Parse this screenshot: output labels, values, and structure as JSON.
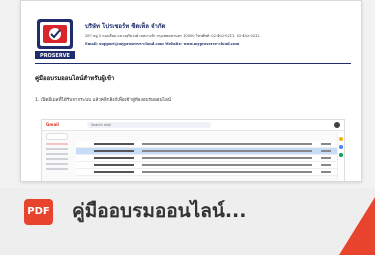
{
  "document": {
    "company_name": "บริษัท โปรเซอร์ท ซีดเท็ล จำกัด",
    "company_address": "287 หมู่ 5 ถนนสีลม แขวงสุริยวงศ์ เขตบางรัก กรุงเทพมหานคร 10500 โทรศัพท์: 02-402-0211, 02-402-0212",
    "company_contact": "Email: support@myproserve-cloud.com  Website: www.myproserve-cloud.com",
    "title": "คู่มืออบรมออนไลน์สำหรับผู้เข้า",
    "step_1": "1. เปิดอีเมลที่ได้รับจากระบบ แล้วคลิกลิงก์เพื่อเข้าสู่ห้องอบรมออนไลน์",
    "logo_text": "PROSERVE",
    "screenshot": {
      "app_name": "Gmail",
      "search_placeholder": "Search mail"
    }
  },
  "file": {
    "type_badge": "PDF",
    "name": "คู่มืออบรมออนไลน์..."
  },
  "colors": {
    "accent": "#e8432c",
    "brand": "#1f2e6b",
    "bar_bg": "#eeeeee"
  }
}
